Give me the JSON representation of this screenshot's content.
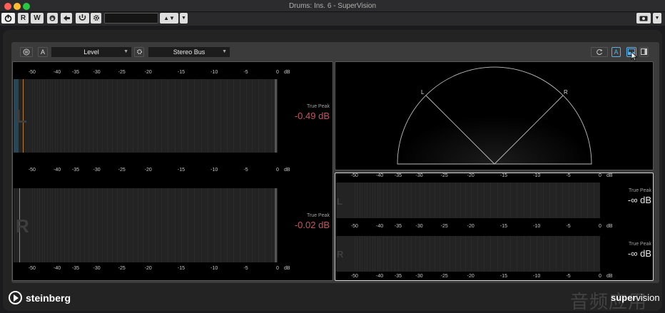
{
  "window": {
    "title": "Drums: Ins. 6 - SuperVision"
  },
  "toolbar": {
    "r_label": "R",
    "w_label": "W",
    "preset_value": "",
    "camera_label": "◙"
  },
  "header": {
    "mode_a_label": "A",
    "module_select": "Level",
    "bus_select": "Stereo Bus",
    "layout_a_label": "A"
  },
  "level_meter": {
    "ticks": [
      "-50",
      "-40",
      "-35",
      "-30",
      "-25",
      "-20",
      "-15",
      "-10",
      "-5",
      "0"
    ],
    "unit": "dB",
    "channels": [
      {
        "letter": "L",
        "true_peak_label": "True Peak",
        "true_peak_value": "-0.49 dB",
        "fill_fraction": 0.02
      },
      {
        "letter": "R",
        "true_peak_label": "True Peak",
        "true_peak_value": "-0.02 dB",
        "fill_fraction": 0.0
      }
    ]
  },
  "phase_scope": {
    "left_label": "L",
    "right_label": "R"
  },
  "small_meter": {
    "ticks": [
      "-50",
      "-40",
      "-35",
      "-30",
      "-25",
      "-20",
      "-15",
      "-10",
      "-5",
      "0"
    ],
    "unit": "dB",
    "channels": [
      {
        "letter": "L",
        "true_peak_label": "True Peak",
        "true_peak_value": "-∞ dB"
      },
      {
        "letter": "R",
        "true_peak_label": "True Peak",
        "true_peak_value": "-∞ dB"
      }
    ]
  },
  "footer": {
    "brand": "steinberg",
    "product_bold": "super",
    "product_light": "vision",
    "watermark": "音频应用"
  },
  "colors": {
    "peak_red": "#c55560",
    "meter_fill": "#274657",
    "peak_marker": "#b8792e"
  }
}
